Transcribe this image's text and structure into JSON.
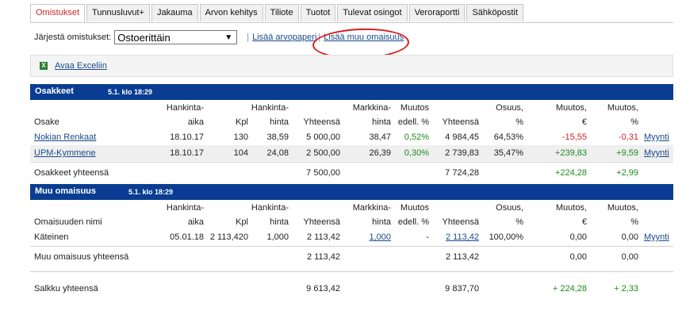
{
  "tabs": [
    "Omistukset",
    "Tunnusluvut+",
    "Jakauma",
    "Arvon kehitys",
    "Tiliote",
    "Tuotot",
    "Tulevat osingot",
    "Veroraportti",
    "Sähköpostit"
  ],
  "sort": {
    "label": "Järjestä omistukset:",
    "selected": "Ostoerittäin",
    "sep": "|",
    "link1": "Lisää arvopaperi",
    "link2": "Lisää muu omaisuus"
  },
  "excel": {
    "label": "Avaa Exceliin",
    "icon": "excel-icon"
  },
  "colors": {
    "header_blue": "#0a3d91",
    "positive": "#1c8c1c",
    "negative": "#d2232a",
    "link": "#1a4a8a",
    "annotation": "#d81e1e"
  },
  "osakkeet": {
    "title": "Osakkeet",
    "time": "5.1. klo 18:29",
    "head_top": [
      "Hankinta-",
      "Hankinta-",
      "Markkina-",
      "Muutos",
      "Osuus,",
      "Muutos,",
      "Muutos,"
    ],
    "head_bot": [
      "Osake",
      "aika",
      "Kpl",
      "hinta",
      "Yhteensä",
      "hinta",
      "edell. %",
      "Yhteensä",
      "%",
      "€",
      "%"
    ],
    "rows": [
      {
        "name": "Nokian Renkaat",
        "aika": "18.10.17",
        "kpl": "130",
        "hinta": "38,59",
        "yht": "5 000,00",
        "mhinta": "38,47",
        "edell": "0,52%",
        "myht": "4 984,45",
        "osuus": "64,53%",
        "mue": "-15,55",
        "mup": "-0,31",
        "action": "Myynti"
      },
      {
        "name": "UPM-Kymmene",
        "aika": "18.10.17",
        "kpl": "104",
        "hinta": "24,08",
        "yht": "2 500,00",
        "mhinta": "26,39",
        "edell": "0,30%",
        "myht": "2 739,83",
        "osuus": "35,47%",
        "mue": "+239,83",
        "mup": "+9,59",
        "action": "Myynti"
      }
    ],
    "total": {
      "label": "Osakkeet yhteensä",
      "yht": "7 500,00",
      "myht": "7 724,28",
      "mue": "+224,28",
      "mup": "+2,99"
    }
  },
  "muu": {
    "title": "Muu omaisuus",
    "time": "5.1. klo 18:29",
    "head_top": [
      "Hankinta-",
      "Hankinta-",
      "Markkina-",
      "Muutos",
      "Osuus,",
      "Muutos,",
      "Muutos,"
    ],
    "head_bot": [
      "Omaisuuden nimi",
      "aika",
      "Kpl",
      "hinta",
      "Yhteensä",
      "hinta",
      "edell. %",
      "Yhteensä",
      "%",
      "€",
      "%"
    ],
    "row": {
      "name": "Käteinen",
      "aika": "05.01.18",
      "kpl": "2 113,420",
      "hinta": "1,000",
      "yht": "2 113,42",
      "mhinta": "1,000",
      "edell": "-",
      "myht": "2 113,42",
      "osuus": "100,00%",
      "mue": "0,00",
      "mup": "0,00",
      "action": "Myynti"
    },
    "total": {
      "label": "Muu omaisuus yhteensä",
      "yht": "2 113,42",
      "myht": "2 113,42",
      "mue": "0,00",
      "mup": "0,00"
    }
  },
  "salkku": {
    "label": "Salkku yhteensä",
    "yht": "9 613,42",
    "myht": "9 837,70",
    "mue": "+ 224,28",
    "mup": "+ 2,33"
  }
}
